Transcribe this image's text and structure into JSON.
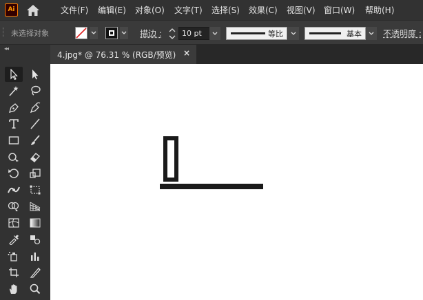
{
  "app": {
    "logo_text": "Ai",
    "home_icon": "home-icon"
  },
  "menu": {
    "items": [
      "文件(F)",
      "编辑(E)",
      "对象(O)",
      "文字(T)",
      "选择(S)",
      "效果(C)",
      "视图(V)",
      "窗口(W)",
      "帮助(H)"
    ]
  },
  "control_bar": {
    "selection_status": "未选择对象",
    "stroke_label": "描边 :",
    "stroke_weight": "10 pt",
    "variable_width_profile": "等比",
    "brush_definition": "基本",
    "opacity_label": "不透明度 :",
    "fill_swatch": "none",
    "stroke_swatch": "black"
  },
  "toolbar": {
    "collapse_label": "◂◂",
    "tools": [
      "selection-tool",
      "direct-selection-tool",
      "magic-wand-tool",
      "lasso-tool",
      "pen-tool",
      "curvature-tool",
      "type-tool",
      "line-segment-tool",
      "rectangle-tool",
      "paintbrush-tool",
      "shaper-tool",
      "eraser-tool",
      "rotate-tool",
      "scale-tool",
      "width-tool",
      "free-transform-tool",
      "shape-builder-tool",
      "perspective-grid-tool",
      "mesh-tool",
      "gradient-tool",
      "eyedropper-tool",
      "blend-tool",
      "symbol-sprayer-tool",
      "column-graph-tool",
      "artboard-tool",
      "slice-tool",
      "hand-tool",
      "zoom-tool"
    ]
  },
  "document": {
    "tab_title": "4.jpg* @ 76.31 % (RGB/预览)",
    "close_label": "×"
  },
  "colors": {
    "ui_dark": "#323232",
    "control_bar": "#3a3a3a",
    "tab_active": "#3b3b3b",
    "canvas": "#ffffff",
    "artwork": "#1a1a1a"
  }
}
